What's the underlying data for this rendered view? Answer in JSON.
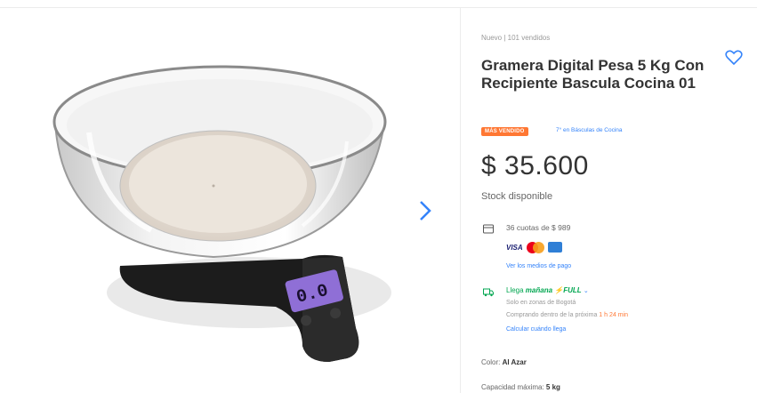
{
  "product": {
    "meta": "Nuevo  |  101 vendidos",
    "title": "Gramera Digital Pesa 5 Kg Con Recipiente Bascula Cocina 01",
    "badge": "MÁS VENDIDO",
    "rank": "7° en Básculas de Cocina",
    "price": "$ 35.600",
    "stock": "Stock disponible"
  },
  "payment": {
    "installments": "36 cuotas de $ 989",
    "methods_link": "Ver los medios de pago",
    "cards": [
      "visa-logo",
      "mastercard-logo",
      "amex-logo"
    ],
    "visa_label": "VISA"
  },
  "shipping": {
    "arrives_prefix": "Llega ",
    "arrives_day": "mañana",
    "full_label": "⚡FULL",
    "zone": "Solo en zonas de Bogotá",
    "buy_prefix": "Comprando dentro de la próxima ",
    "time_left": "1 h 24 min",
    "calc_link": "Calcular cuándo llega"
  },
  "attributes": {
    "color_label": "Color: ",
    "color_value": "Al Azar",
    "capacity_label": "Capacidad máxima: ",
    "capacity_value": "5 kg"
  },
  "scale_display": "0.0",
  "colors": {
    "accent_blue": "#3483fa",
    "badge_orange": "#ff7733",
    "green": "#00a650",
    "display_purple": "#8f6fd6"
  }
}
